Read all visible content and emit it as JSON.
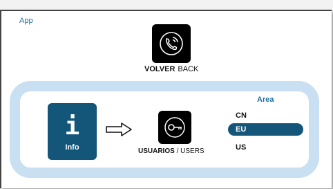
{
  "app": {
    "label": "App"
  },
  "back": {
    "label_es": "VOLVER",
    "label_en": "BACK"
  },
  "info": {
    "glyph": "i",
    "label": "Info"
  },
  "users": {
    "label_es": "USUARIOS",
    "separator": "/",
    "label_en": "USERS"
  },
  "area": {
    "title": "Area",
    "options": [
      "CN",
      "EU",
      "US"
    ],
    "selected": "EU"
  },
  "colors": {
    "accent": "#14567a",
    "panel_border": "#c8e0f1",
    "label_blue": "#1e6fa0"
  },
  "icons": {
    "back": "phone-call-icon",
    "users": "key-icon",
    "arrow": "right-arrow-icon"
  }
}
